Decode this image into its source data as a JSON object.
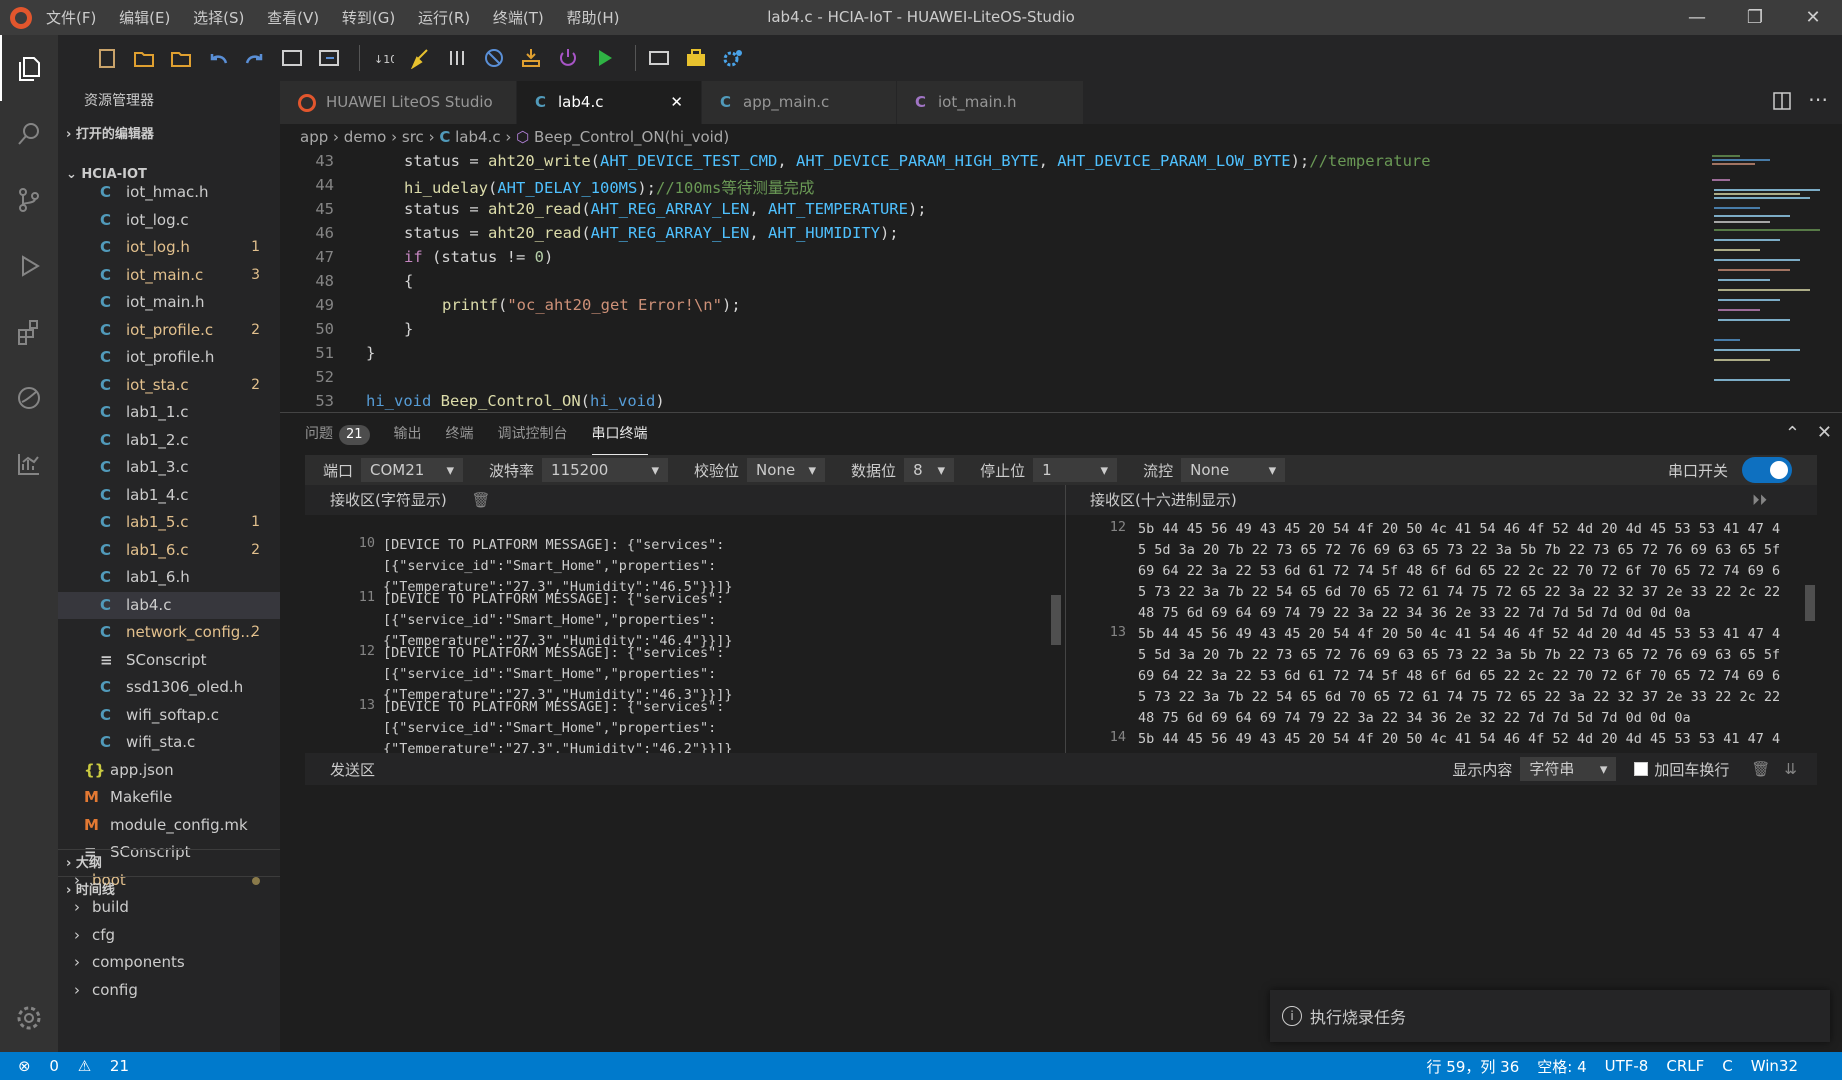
{
  "window": {
    "title": "lab4.c - HCIA-IoT - HUAWEI-LiteOS-Studio",
    "menu": [
      "文件(F)",
      "编辑(E)",
      "选择(S)",
      "查看(V)",
      "转到(G)",
      "运行(R)",
      "终端(T)",
      "帮助(H)"
    ],
    "minimize": "—",
    "maximize": "❐",
    "close": "✕"
  },
  "sidebar": {
    "header": "资源管理器",
    "open_editors": "打开的编辑器",
    "project": "HCIA-IOT",
    "files": [
      {
        "icon": "C",
        "name": "iot_hmac.h",
        "badge": "",
        "modified": false
      },
      {
        "icon": "C",
        "name": "iot_log.c",
        "badge": "",
        "modified": false
      },
      {
        "icon": "C",
        "name": "iot_log.h",
        "badge": "1",
        "modified": true
      },
      {
        "icon": "C",
        "name": "iot_main.c",
        "badge": "3",
        "modified": true
      },
      {
        "icon": "C",
        "name": "iot_main.h",
        "badge": "",
        "modified": false
      },
      {
        "icon": "C",
        "name": "iot_profile.c",
        "badge": "2",
        "modified": true
      },
      {
        "icon": "C",
        "name": "iot_profile.h",
        "badge": "",
        "modified": false
      },
      {
        "icon": "C",
        "name": "iot_sta.c",
        "badge": "2",
        "modified": true
      },
      {
        "icon": "C",
        "name": "lab1_1.c",
        "badge": "",
        "modified": false
      },
      {
        "icon": "C",
        "name": "lab1_2.c",
        "badge": "",
        "modified": false
      },
      {
        "icon": "C",
        "name": "lab1_3.c",
        "badge": "",
        "modified": false
      },
      {
        "icon": "C",
        "name": "lab1_4.c",
        "badge": "",
        "modified": false
      },
      {
        "icon": "C",
        "name": "lab1_5.c",
        "badge": "1",
        "modified": true
      },
      {
        "icon": "C",
        "name": "lab1_6.c",
        "badge": "2",
        "modified": true
      },
      {
        "icon": "C",
        "name": "lab1_6.h",
        "badge": "",
        "modified": false
      },
      {
        "icon": "C",
        "name": "lab4.c",
        "badge": "",
        "modified": false
      },
      {
        "icon": "C",
        "name": "network_config...",
        "badge": "2",
        "modified": true
      },
      {
        "icon": "≡",
        "name": "SConscript",
        "badge": "",
        "modified": false
      },
      {
        "icon": "C",
        "name": "ssd1306_oled.h",
        "badge": "",
        "modified": false
      },
      {
        "icon": "C",
        "name": "wifi_softap.c",
        "badge": "",
        "modified": false
      },
      {
        "icon": "C",
        "name": "wifi_sta.c",
        "badge": "",
        "modified": false
      }
    ],
    "root_files": [
      {
        "icon": "{}",
        "name": "app.json"
      },
      {
        "icon": "M",
        "name": "Makefile"
      },
      {
        "icon": "M",
        "name": "module_config.mk"
      },
      {
        "icon": "≡",
        "name": "SConscript"
      }
    ],
    "folders": [
      "boot",
      "build",
      "cfg",
      "components",
      "config"
    ],
    "outline": "大纲",
    "timeline": "时间线"
  },
  "tabs": [
    {
      "icon": "studio",
      "label": "HUAWEI LiteOS Studio"
    },
    {
      "icon": "C",
      "label": "lab4.c"
    },
    {
      "icon": "C",
      "label": "app_main.c"
    },
    {
      "icon": "C",
      "label": "iot_main.h"
    }
  ],
  "breadcrumb": {
    "p1": "app",
    "p2": "demo",
    "p3": "src",
    "p4": "lab4.c",
    "p5": "Beep_Control_ON(hi_void)"
  },
  "editor": {
    "line_numbers": [
      "43",
      "44",
      "45",
      "46",
      "47",
      "48",
      "49",
      "50",
      "51",
      "52",
      "53"
    ],
    "code": {
      "l43a": "status = ",
      "l43f": "aht20_write",
      "l43b": "(",
      "l43m1": "AHT_DEVICE_TEST_CMD",
      "l43c": ", ",
      "l43m2": "AHT_DEVICE_PARAM_HIGH_BYTE",
      "l43d": ", ",
      "l43m3": "AHT_DEVICE_PARAM_LOW_BYTE",
      "l43e": ");",
      "l43cm": "//temperature",
      "l44f": "hi_udelay",
      "l44b": "(",
      "l44m": "AHT_DELAY_100MS",
      "l44e": ");",
      "l44cm": "//100ms等待测量完成",
      "l45a": "status = ",
      "l45f": "aht20_read",
      "l45b": "(",
      "l45m1": "AHT_REG_ARRAY_LEN",
      "l45c": ", ",
      "l45m2": "AHT_TEMPERATURE",
      "l45e": ");",
      "l46a": "status = ",
      "l46f": "aht20_read",
      "l46b": "(",
      "l46m1": "AHT_REG_ARRAY_LEN",
      "l46c": ", ",
      "l46m2": "AHT_HUMIDITY",
      "l46e": ");",
      "l47k": "if",
      "l47a": " (status != ",
      "l47n": "0",
      "l47e": ")",
      "l48": "{",
      "l49f": "printf",
      "l49b": "(",
      "l49s": "\"oc_aht20_get Error!\\n\"",
      "l49e": ");",
      "l50": "}",
      "l51": "}",
      "l53t": "hi_void",
      "l53f": "Beep_Control_ON",
      "l53b": "(",
      "l53t2": "hi_void",
      "l53e": ")"
    }
  },
  "panel": {
    "tabs": [
      "问题",
      "输出",
      "终端",
      "调试控制台",
      "串口终端"
    ],
    "problems_count": "21",
    "config": {
      "port_label": "端口",
      "port": "COM21",
      "baud_label": "波特率",
      "baud": "115200",
      "parity_label": "校验位",
      "parity": "None",
      "databits_label": "数据位",
      "databits": "8",
      "stopbits_label": "停止位",
      "stopbits": "1",
      "flow_label": "流控",
      "flow": "None",
      "serial_switch_label": "串口开关"
    },
    "rx_string_title": "接收区(字符显示)",
    "rx_hex_title": "接收区(十六进制显示)",
    "rx_string_rows": [
      {
        "n": "10",
        "text": "[DEVICE TO PLATFORM MESSAGE]: {\"services\":[{\"service_id\":\"Smart_Home\",\"properties\":{\"Temperature\":\"27.3\",\"Humidity\":\"46.5\"}}]}"
      },
      {
        "n": "11",
        "text": "[DEVICE TO PLATFORM MESSAGE]: {\"services\":[{\"service_id\":\"Smart_Home\",\"properties\":{\"Temperature\":\"27.3\",\"Humidity\":\"46.4\"}}]}"
      },
      {
        "n": "12",
        "text": "[DEVICE TO PLATFORM MESSAGE]: {\"services\":[{\"service_id\":\"Smart_Home\",\"properties\":{\"Temperature\":\"27.3\",\"Humidity\":\"46.3\"}}]}"
      },
      {
        "n": "13",
        "text": "[DEVICE TO PLATFORM MESSAGE]: {\"services\":[{\"service_id\":\"Smart_Home\",\"properties\":{\"Temperature\":\"27.3\",\"Humidity\":\"46.2\"}}]}"
      }
    ],
    "rx_hex_rows": [
      {
        "n": "12",
        "text": "5b 44 45 56 49 43 45 20 54 4f 20 50 4c 41 54 46 4f 52 4d 20 4d 45 53 53 41 47 45 5d 3a 20 7b 22 73 65 72 76 69 63 65 73 22 3a 5b 7b 22 73 65 72 76 69 63 65 5f 69 64 22 3a 22 53 6d 61 72 74 5f 48 6f 6d 65 22 2c 22 70 72 6f 70 65 72 74 69 65 73 22 3a 7b 22 54 65 6d 70 65 72 61 74 75 72 65 22 3a 22 32 37 2e 33 22 2c 22 48 75 6d 69 64 69 74 79 22 3a 22 34 36 2e 33 22 7d 7d 5d 7d 0d 0d 0a"
      },
      {
        "n": "13",
        "text": "5b 44 45 56 49 43 45 20 54 4f 20 50 4c 41 54 46 4f 52 4d 20 4d 45 53 53 41 47 45 5d 3a 20 7b 22 73 65 72 76 69 63 65 73 22 3a 5b 7b 22 73 65 72 76 69 63 65 5f 69 64 22 3a 22 53 6d 61 72 74 5f 48 6f 6d 65 22 2c 22 70 72 6f 70 65 72 74 69 65 73 22 3a 7b 22 54 65 6d 70 65 72 61 74 75 72 65 22 3a 22 32 37 2e 33 22 2c 22 48 75 6d 69 64 69 74 79 22 3a 22 34 36 2e 32 22 7d 7d 5d 7d 0d 0d 0a"
      },
      {
        "n": "14",
        "text": "5b 44 45 56 49 43 45 20 54 4f 20 50 4c 41 54 46 4f 52 4d 20 4d 45 53 53 41 47 45"
      }
    ],
    "send": {
      "title": "发送区",
      "display_label": "显示内容",
      "display_value": "字符串",
      "crlf_label": "加回车换行"
    }
  },
  "toast": {
    "text": "执行烧录任务"
  },
  "statusbar": {
    "errors": "0",
    "warnings": "21",
    "position": "行 59，列 36",
    "spaces": "空格: 4",
    "encoding": "UTF-8",
    "eol": "CRLF",
    "language": "C",
    "platform": "Win32"
  },
  "colors": {
    "accent": "#007acc",
    "modified": "#e2c08d",
    "c_icon": "#519aba"
  }
}
